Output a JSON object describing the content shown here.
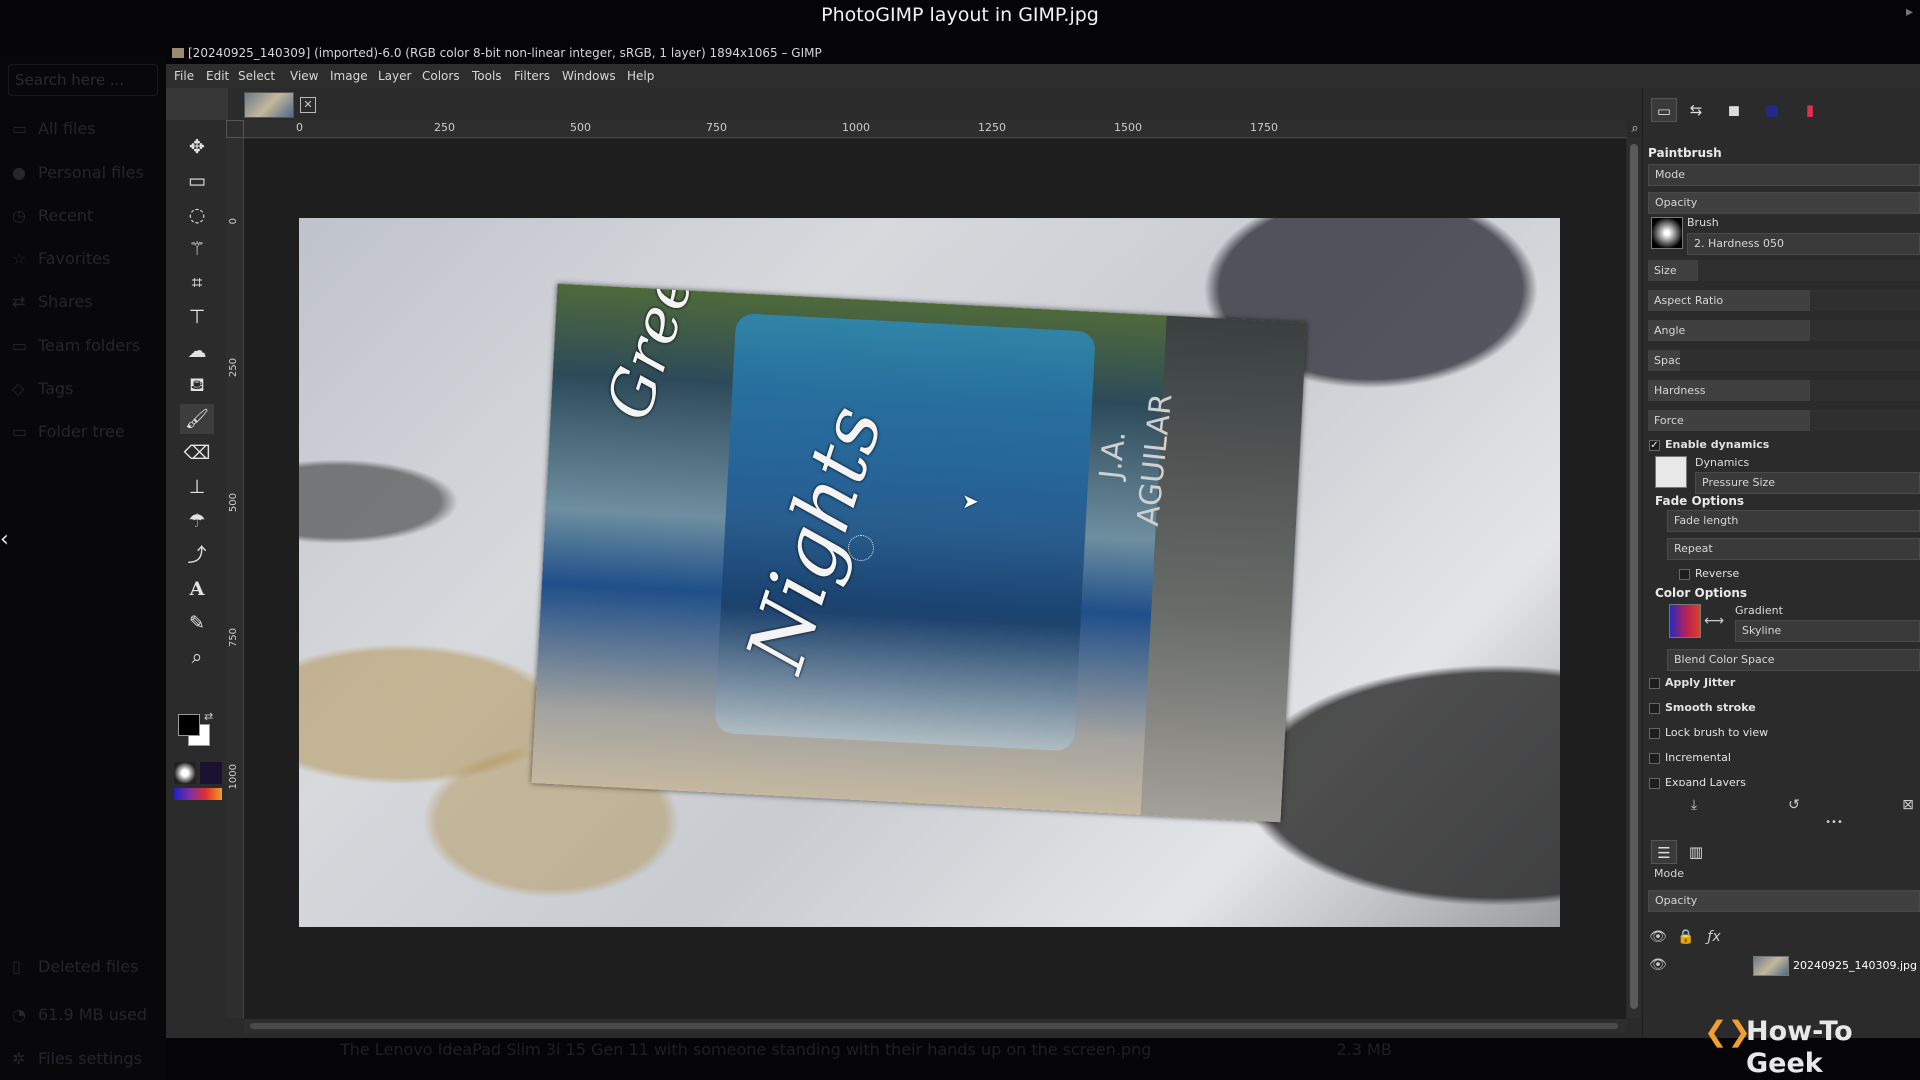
{
  "viewer": {
    "title": "PhotoGIMP layout in GIMP.jpg",
    "search_placeholder": "Search here ...",
    "sidebar": [
      {
        "label": "All files",
        "icon": "folder-icon"
      },
      {
        "label": "Personal files",
        "icon": "user-icon"
      },
      {
        "label": "Recent",
        "icon": "clock-icon"
      },
      {
        "label": "Favorites",
        "icon": "star-icon"
      },
      {
        "label": "Shares",
        "icon": "share-icon"
      },
      {
        "label": "Team folders",
        "icon": "team-folder-icon"
      },
      {
        "label": "Tags",
        "icon": "tag-icon"
      },
      {
        "label": "Folder tree",
        "icon": "folder-tree-icon"
      }
    ],
    "bottom": [
      {
        "label": "Deleted files",
        "icon": "trash-icon"
      },
      {
        "label": "61.9 MB used",
        "icon": "storage-icon"
      },
      {
        "label": "Files settings",
        "icon": "gear-icon"
      }
    ],
    "status_caption": "The Lenovo IdeaPad Slim 3i 15 Gen 11 with someone standing with their hands up on the screen.png",
    "status_size": "2.3 MB"
  },
  "gimp": {
    "window_title": "[20240925_140309] (imported)-6.0 (RGB color 8-bit non-linear integer, sRGB, 1 layer) 1894x1065 – GIMP",
    "menu": [
      "File",
      "Edit",
      "Select",
      "View",
      "Image",
      "Layer",
      "Colors",
      "Tools",
      "Filters",
      "Windows",
      "Help"
    ],
    "ruler_h": [
      "0",
      "250",
      "500",
      "750",
      "1000",
      "1250",
      "1500",
      "1750"
    ],
    "ruler_v": [
      "0",
      "250",
      "500",
      "750",
      "1000"
    ],
    "book": {
      "title_line1": "Greenville",
      "title_line2": "Nights",
      "author_line1": "J.A.",
      "author_line2": "AGUILAR"
    }
  },
  "tool_options": {
    "tool_name": "Paintbrush",
    "mode_label": "Mode",
    "opacity_label": "Opacity",
    "brush_label": "Brush",
    "brush_value": "2. Hardness 050",
    "size_label": "Size",
    "aspect_ratio_label": "Aspect Ratio",
    "angle_label": "Angle",
    "spacing_label": "Spacing",
    "hardness_label": "Hardness",
    "force_label": "Force",
    "enable_dynamics": "Enable dynamics",
    "dynamics_label": "Dynamics",
    "dynamics_value": "Pressure Size",
    "fade_options": "Fade Options",
    "fade_length": "Fade length",
    "repeat": "Repeat",
    "reverse": "Reverse",
    "color_options": "Color Options",
    "gradient_label": "Gradient",
    "gradient_value": "Skyline",
    "blend_color_space": "Blend Color Space",
    "apply_jitter": "Apply Jitter",
    "smooth_stroke": "Smooth stroke",
    "lock_brush": "Lock brush to view",
    "incremental": "Incremental",
    "expand_layers": "Expand Layers"
  },
  "layers": {
    "mode_label": "Mode",
    "opacity_label": "Opacity",
    "layer_name": "20240925_140309.jpg"
  },
  "watermark": "How-To Geek"
}
